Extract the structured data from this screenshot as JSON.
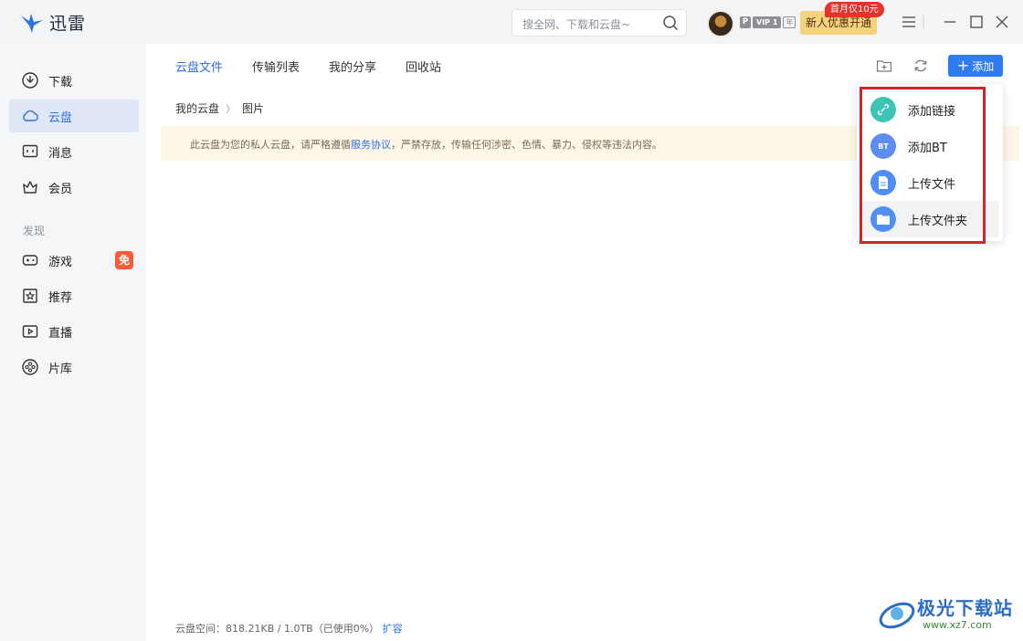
{
  "app": {
    "name": "迅雷",
    "search_placeholder": "搜全网、下载和云盘~",
    "vip_prefix": "P",
    "vip_label": "VIP 1",
    "vip_year": "年",
    "promo_button": "新人优惠开通",
    "promo_badge": "首月仅10元"
  },
  "sidebar": {
    "items": [
      {
        "label": "下载",
        "icon": "download-icon"
      },
      {
        "label": "云盘",
        "icon": "cloud-icon",
        "active": true
      },
      {
        "label": "消息",
        "icon": "message-icon"
      },
      {
        "label": "会员",
        "icon": "crown-icon"
      }
    ],
    "section_label": "发现",
    "discover": [
      {
        "label": "游戏",
        "icon": "gamepad-icon",
        "badge": "免"
      },
      {
        "label": "推荐",
        "icon": "star-icon"
      },
      {
        "label": "直播",
        "icon": "live-icon"
      },
      {
        "label": "片库",
        "icon": "film-reel-icon"
      }
    ]
  },
  "main": {
    "tabs": [
      "云盘文件",
      "传输列表",
      "我的分享",
      "回收站"
    ],
    "active_tab": "云盘文件",
    "add_button": "添加",
    "breadcrumb": [
      "我的云盘",
      "图片"
    ],
    "notice_before": "此云盘为您的私人云盘，请严格遵循",
    "notice_link": "服务协议",
    "notice_after": "，严禁存放，传输任何涉密、色情、暴力、侵权等违法内容。",
    "footer_text": "云盘空间：818.21KB / 1.0TB（已使用0%）",
    "footer_link": "扩容"
  },
  "dropdown": {
    "items": [
      {
        "label": "添加链接",
        "icon": "link-icon",
        "color": "#3cc5b4"
      },
      {
        "label": "添加BT",
        "icon": "bt-file-icon",
        "icon_text": "BT",
        "color": "#5b8ef0"
      },
      {
        "label": "上传文件",
        "icon": "file-icon",
        "color": "#4f8ef2"
      },
      {
        "label": "上传文件夹",
        "icon": "folder-icon",
        "color": "#4f8ef2"
      }
    ]
  },
  "watermark": {
    "title": "极光下载站",
    "url": "www.xz7.com"
  },
  "colors": {
    "accent": "#2f6fe4",
    "highlight": "#d3262c"
  }
}
